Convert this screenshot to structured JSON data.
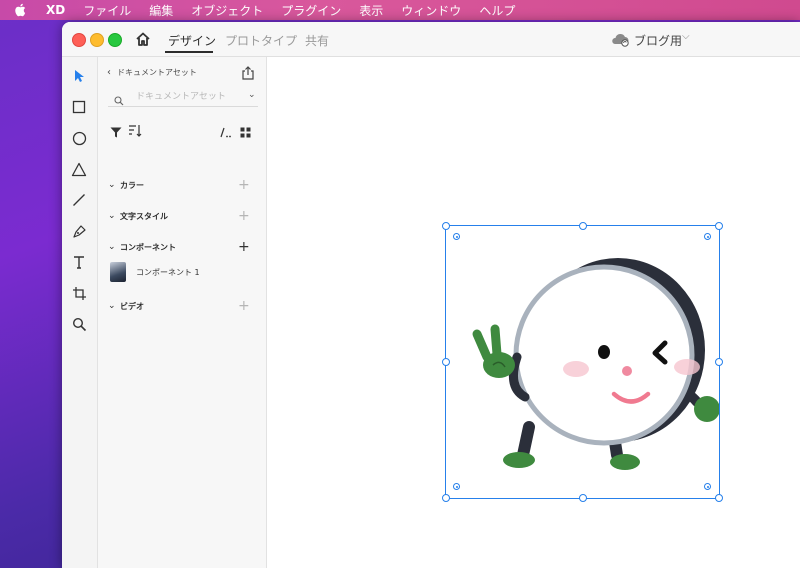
{
  "menubar": {
    "app_name": "XD",
    "items": [
      "ファイル",
      "編集",
      "オブジェクト",
      "プラグイン",
      "表示",
      "ウィンドウ",
      "ヘルプ"
    ]
  },
  "titlebar": {
    "tabs": [
      "デザイン",
      "プロトタイプ",
      "共有"
    ],
    "active_tab": "デザイン",
    "document_name": "ブログ用",
    "document_chevron": "⌵"
  },
  "toolbar": {
    "tools": [
      "select-tool",
      "rectangle-tool",
      "ellipse-tool",
      "polygon-tool",
      "line-tool",
      "pen-tool",
      "text-tool",
      "artboard-tool",
      "zoom-tool"
    ],
    "active_tool": "select-tool"
  },
  "assets_panel": {
    "back_label": "ドキュメントアセット",
    "search_placeholder": "ドキュメントアセット",
    "sections": [
      {
        "label": "カラー",
        "plus": "+"
      },
      {
        "label": "文字スタイル",
        "plus": "+"
      },
      {
        "label": "コンポーネント",
        "plus": "+"
      },
      {
        "label": "ビデオ",
        "plus": "+"
      }
    ],
    "component_item": "コンポーネント 1"
  },
  "colors": {
    "selection": "#2680eb",
    "character_outline": "#a9b2bd",
    "character_shadow": "#2b2f3a",
    "glove_green": "#3f8a3f",
    "cheek_pink": "#f6c5cf"
  }
}
